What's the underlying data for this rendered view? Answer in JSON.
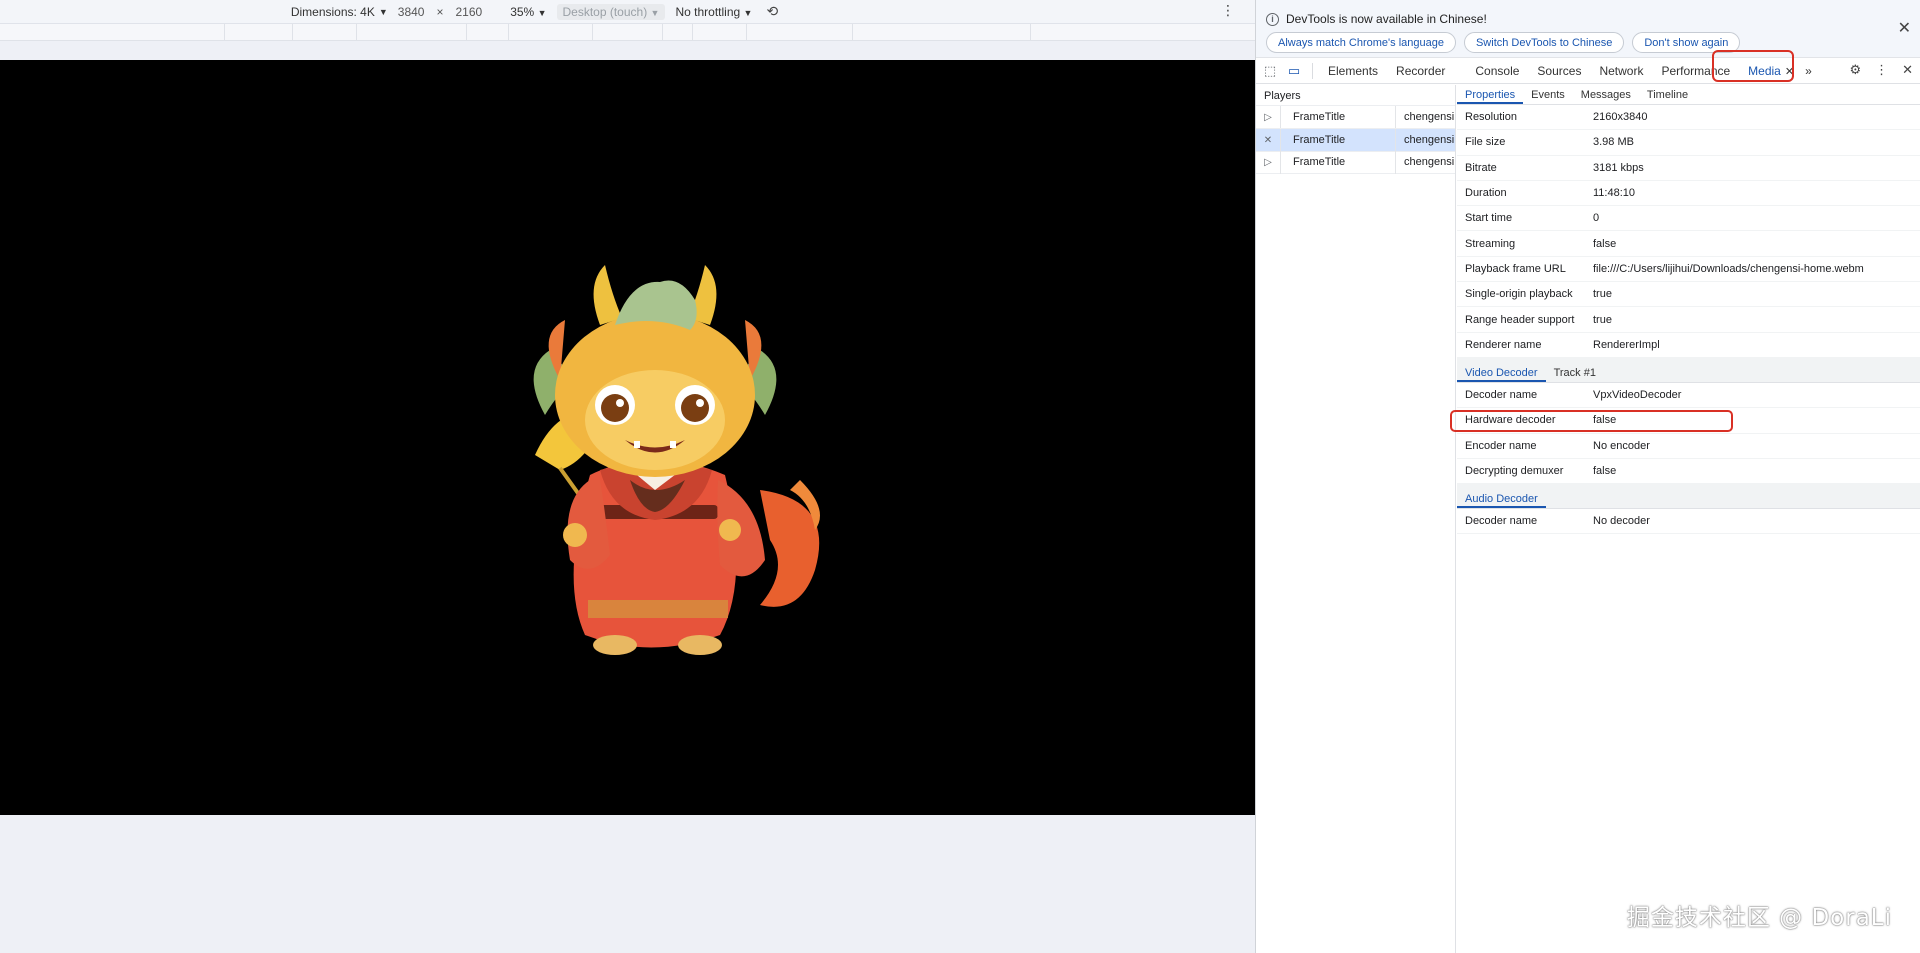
{
  "device_toolbar": {
    "dimensions_label": "Dimensions: 4K",
    "width_value": "3840",
    "times_symbol": "×",
    "height_value": "2160",
    "zoom_label": "35%",
    "device_type_label": "Desktop (touch)",
    "throttling_label": "No throttling",
    "rotate_icon": "rotate-icon",
    "more_icon": "more-vertical-icon"
  },
  "infobar": {
    "message": "DevTools is now available in Chinese!",
    "buttons": [
      "Always match Chrome's language",
      "Switch DevTools to Chinese",
      "Don't show again"
    ],
    "close_symbol": "✕"
  },
  "tabs": {
    "items": [
      "Elements",
      "Recorder",
      "Console",
      "Sources",
      "Network",
      "Performance"
    ],
    "active": "Media",
    "overflow_symbol": "»"
  },
  "players": {
    "header": "Players",
    "rows": [
      {
        "title": "FrameTitle",
        "name": "chengensi",
        "icon": "▷",
        "selected": false
      },
      {
        "title": "FrameTitle",
        "name": "chengensi",
        "icon": "✕",
        "selected": true
      },
      {
        "title": "FrameTitle",
        "name": "chengensi",
        "icon": "▷",
        "selected": false
      }
    ]
  },
  "subtabs": [
    "Properties",
    "Events",
    "Messages",
    "Timeline"
  ],
  "properties": [
    {
      "key": "Resolution",
      "value": "2160x3840"
    },
    {
      "key": "File size",
      "value": "3.98 MB"
    },
    {
      "key": "Bitrate",
      "value": "3181 kbps"
    },
    {
      "key": "Duration",
      "value": "11:48:10"
    },
    {
      "key": "Start time",
      "value": "0"
    },
    {
      "key": "Streaming",
      "value": "false"
    },
    {
      "key": "Playback frame URL",
      "value": "file:///C:/Users/lijihui/Downloads/chengensi-home.webm"
    },
    {
      "key": "Single-origin playback",
      "value": "true"
    },
    {
      "key": "Range header support",
      "value": "true"
    },
    {
      "key": "Renderer name",
      "value": "RendererImpl"
    }
  ],
  "video_decoder": {
    "tabs": [
      "Video Decoder",
      "Track #1"
    ],
    "rows": [
      {
        "key": "Decoder name",
        "value": "VpxVideoDecoder"
      },
      {
        "key": "Hardware decoder",
        "value": "false"
      },
      {
        "key": "Encoder name",
        "value": "No encoder"
      },
      {
        "key": "Decrypting demuxer",
        "value": "false"
      }
    ]
  },
  "audio_decoder": {
    "tabs": [
      "Audio Decoder"
    ],
    "rows": [
      {
        "key": "Decoder name",
        "value": "No decoder"
      }
    ]
  },
  "watermark": "掘金技术社区 @ DoraLi"
}
